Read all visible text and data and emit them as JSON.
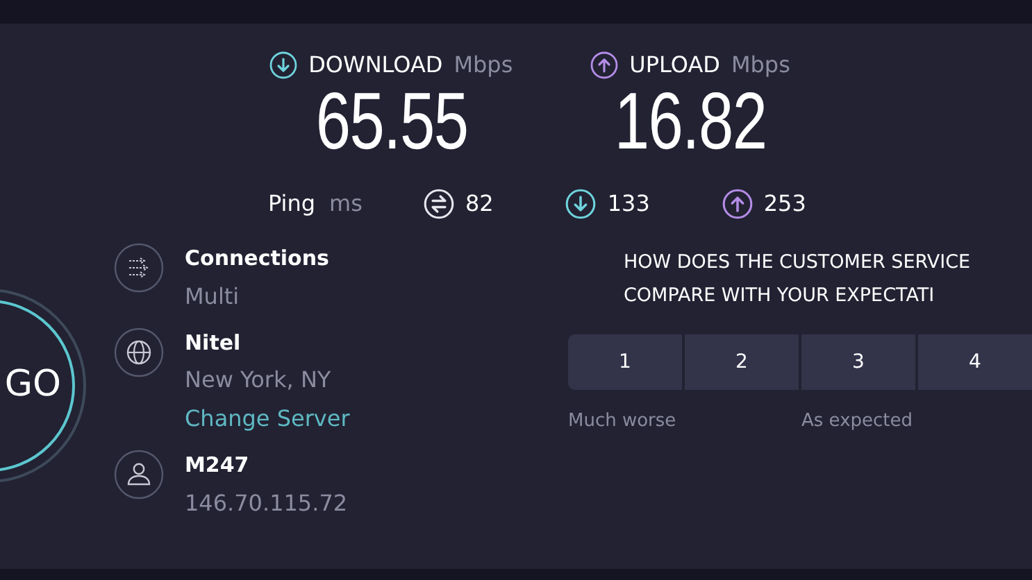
{
  "metrics": [
    {
      "kind": "download",
      "label": "DOWNLOAD",
      "unit": "Mbps",
      "value": "65.55"
    },
    {
      "kind": "upload",
      "label": "UPLOAD",
      "unit": "Mbps",
      "value": "16.82"
    }
  ],
  "ping": {
    "label": "Ping",
    "unit": "ms",
    "items": [
      {
        "kind": "jitter",
        "value": "82"
      },
      {
        "kind": "download",
        "value": "133"
      },
      {
        "kind": "upload",
        "value": "253"
      }
    ]
  },
  "go_button": "GO",
  "info": [
    {
      "kind": "connections",
      "title": "Connections",
      "subtitle": "Multi"
    },
    {
      "kind": "server",
      "title": "Nitel",
      "subtitle": "New York, NY",
      "link": "Change Server"
    },
    {
      "kind": "user",
      "title": "M247",
      "subtitle": "146.70.115.72"
    }
  ],
  "survey": {
    "question_lines": [
      "HOW DOES THE CUSTOMER SERVICE",
      "COMPARE WITH YOUR EXPECTATI"
    ],
    "options": [
      {
        "value": "1",
        "caption": "Much worse"
      },
      {
        "value": "2"
      },
      {
        "value": "3",
        "caption": "As expected"
      },
      {
        "value": "4"
      }
    ]
  }
}
